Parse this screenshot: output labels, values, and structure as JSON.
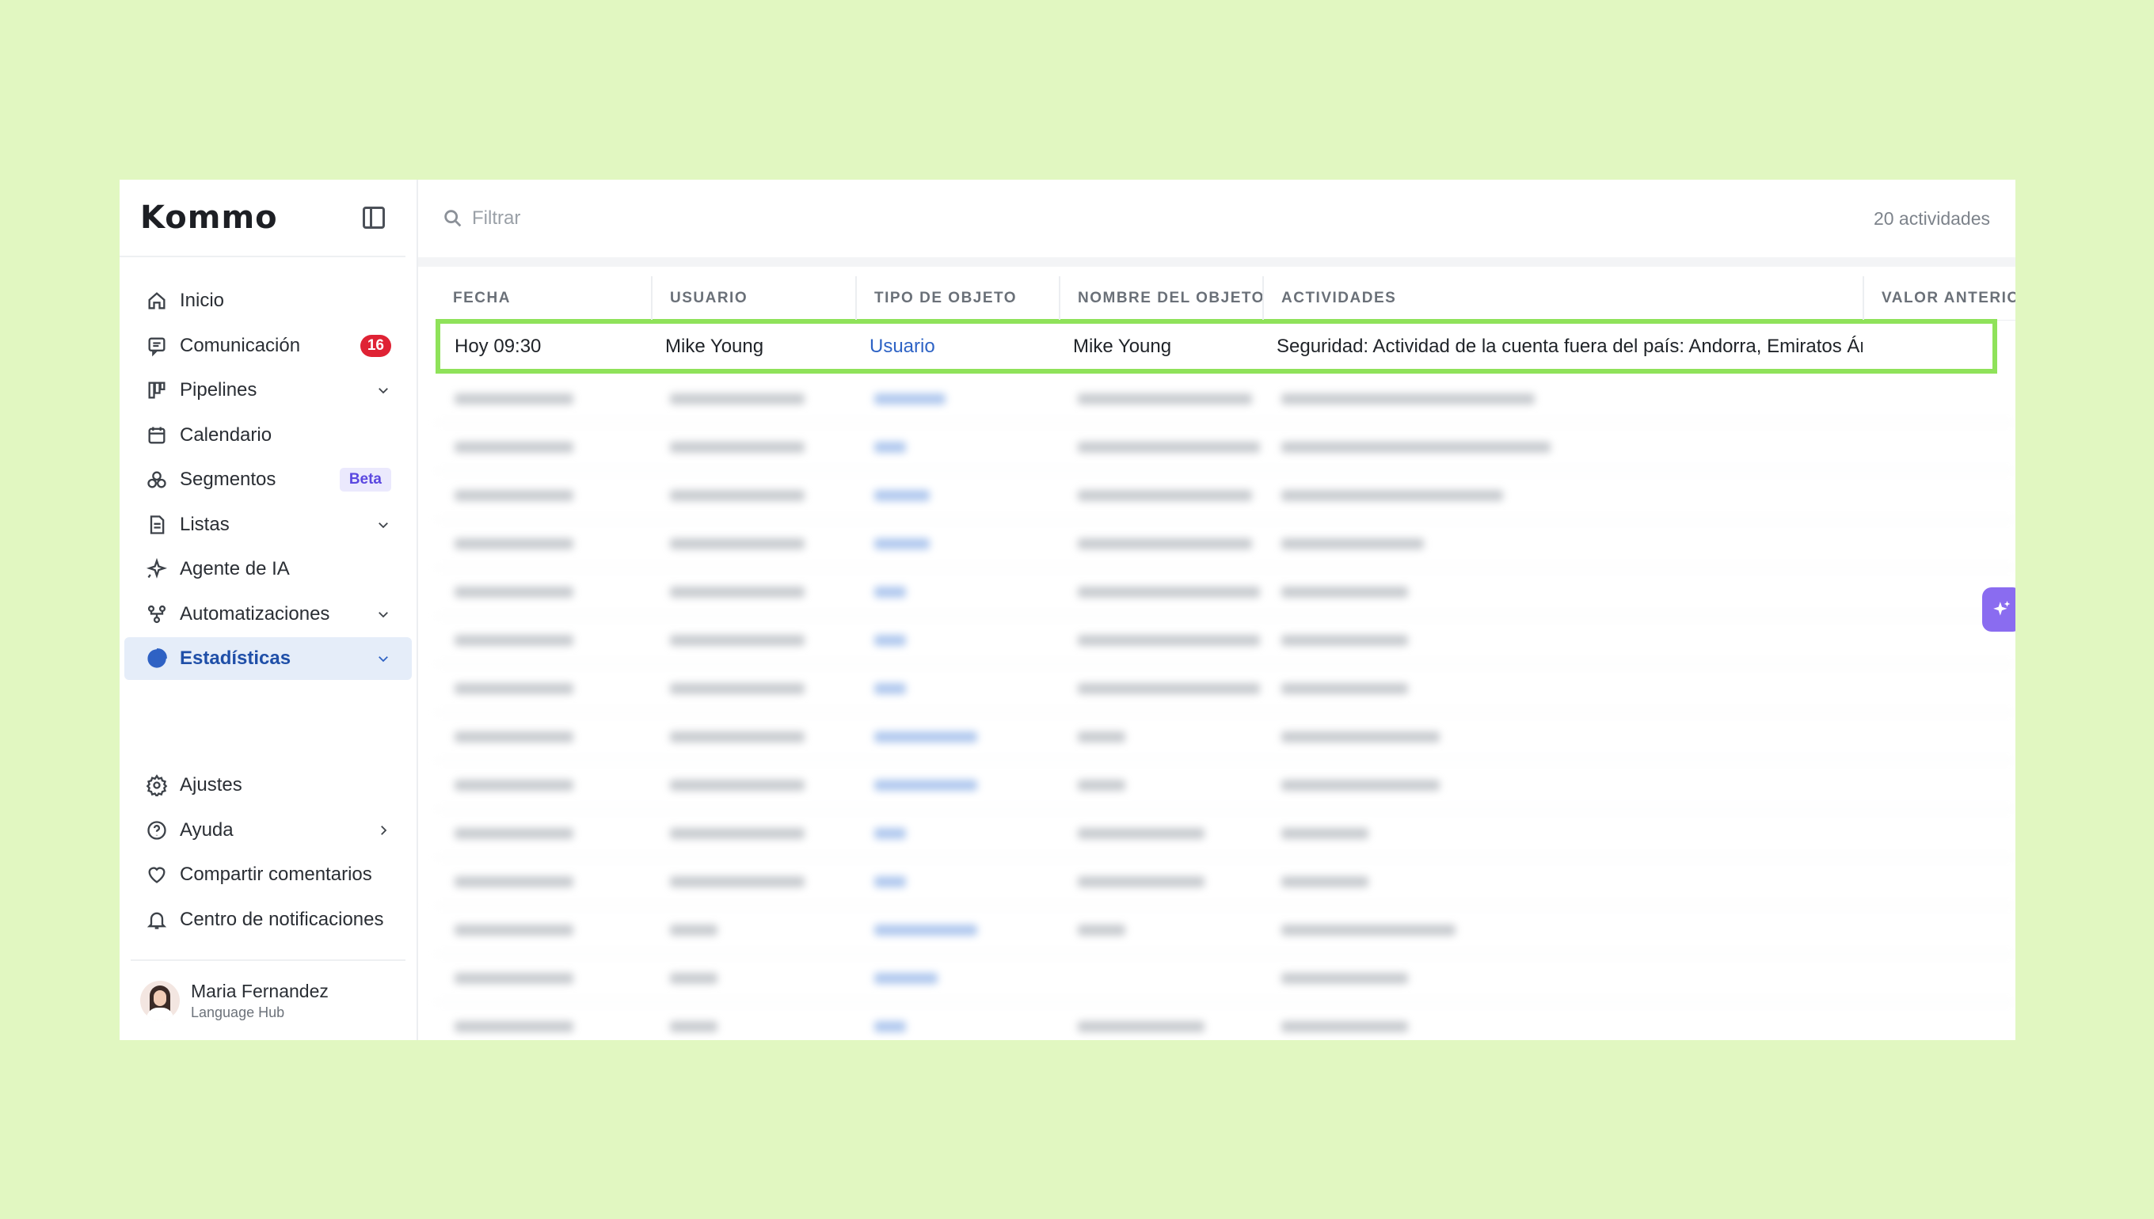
{
  "app": {
    "logo": "Kommo"
  },
  "sidebar": {
    "items": [
      {
        "label": "Inicio",
        "icon": "home-icon"
      },
      {
        "label": "Comunicación",
        "icon": "chat-icon",
        "badge": "16"
      },
      {
        "label": "Pipelines",
        "icon": "pipeline-icon",
        "chevron": "down"
      },
      {
        "label": "Calendario",
        "icon": "calendar-icon"
      },
      {
        "label": "Segmentos",
        "icon": "segments-icon",
        "tag": "Beta"
      },
      {
        "label": "Listas",
        "icon": "list-icon",
        "chevron": "down"
      },
      {
        "label": "Agente de IA",
        "icon": "sparkle-icon"
      },
      {
        "label": "Automatizaciones",
        "icon": "automation-icon",
        "chevron": "down"
      },
      {
        "label": "Estadísticas",
        "icon": "pie-chart-icon",
        "chevron": "down",
        "active": true
      }
    ],
    "bottom_items": [
      {
        "label": "Ajustes",
        "icon": "gear-icon"
      },
      {
        "label": "Ayuda",
        "icon": "help-icon",
        "chevron": "right"
      },
      {
        "label": "Compartir comentarios",
        "icon": "heart-icon"
      },
      {
        "label": "Centro de notificaciones",
        "icon": "bell-icon"
      }
    ],
    "user": {
      "name": "Maria Fernandez",
      "org": "Language Hub"
    }
  },
  "topbar": {
    "filter_placeholder": "Filtrar",
    "count": "20 actividades"
  },
  "table": {
    "columns": [
      "FECHA",
      "USUARIO",
      "TIPO DE OBJETO",
      "NOMBRE DEL OBJETO",
      "ACTIVIDADES",
      "VALOR ANTERIOR"
    ],
    "highlighted_row": {
      "fecha": "Hoy 09:30",
      "usuario": "Mike Young",
      "tipo": "Usuario",
      "nombre": "Mike Young",
      "actividad": "Seguridad: Actividad de la cuenta fuera del país: Andorra, Emiratos Árabes Unidos"
    }
  },
  "colors": {
    "accent": "#2e63c5",
    "highlight": "#8fe25a",
    "background": "#e1f7c1",
    "badge": "#df2234"
  }
}
